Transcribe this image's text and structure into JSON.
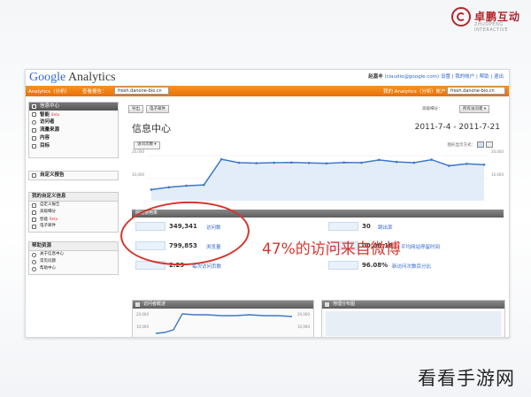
{
  "brand": {
    "name": "卓鹏互动",
    "sub": "ZHUOPENG INTERACTIVE"
  },
  "ga": {
    "logo_google": "Google",
    "logo_analytics": " Analytics",
    "account_user": "赵嘉丰",
    "account_email": "(claudio@google.com)",
    "account_links": "设置 | 我的帐户 | 帮助 | 退出",
    "nav_analytics": "Analytics（分析）",
    "nav_reports": "查看报告：",
    "profile_select": "fresh.danone-bio.cn",
    "nav_right_label": "我的 Analytics（分析）帐户：",
    "account_select": "fresh.danone-bio.cn"
  },
  "sidebar": {
    "main_head": "信息中心",
    "items": [
      {
        "label": "智能",
        "badge": "Beta"
      },
      {
        "label": "访问者",
        "badge": ""
      },
      {
        "label": "流量来源",
        "badge": ""
      },
      {
        "label": "内容",
        "badge": ""
      },
      {
        "label": "目标",
        "badge": ""
      }
    ],
    "custom_reports": "自定义报告",
    "my_custom_head": "我的自定义信息",
    "my_custom_items": [
      {
        "label": "自定义报告",
        "badge": ""
      },
      {
        "label": "高级细分",
        "badge": ""
      },
      {
        "label": "智能",
        "badge": "Beta"
      },
      {
        "label": "电子邮件",
        "badge": ""
      }
    ],
    "help_head": "帮助资源",
    "help_items": [
      "关于信息中心",
      "常见问题",
      "帮助中心"
    ]
  },
  "toolbar": {
    "export_label": "导出",
    "email_label": "电子邮件",
    "compare_label": "高级细分：",
    "compare_value": "所有访问者 ▾"
  },
  "dashboard": {
    "title": "信息中心",
    "date_range": "2011-7-4 - 2011-7-21",
    "graph_button": "访问次数 ▾",
    "graph_mode_label": "图形显示方式："
  },
  "chart_data": {
    "type": "area",
    "series": [
      {
        "values": [
          5100,
          6200,
          6900,
          7300,
          19100,
          17500,
          17300,
          17500,
          17600,
          17400,
          17200,
          17600,
          17500,
          18800,
          17900,
          17500,
          18900,
          16100,
          17000,
          16600
        ]
      }
    ],
    "y_ticks_left": [
      "20,000",
      "10,000"
    ],
    "y_ticks_right": [
      "20,000",
      "10,000"
    ],
    "ylim": [
      0,
      22000
    ],
    "grid": true
  },
  "site_usage": {
    "header": "网站使用率",
    "metrics": [
      {
        "value": "349,341",
        "label": "访问数"
      },
      {
        "value": "799,853",
        "label": "浏览量"
      },
      {
        "value": "2.29",
        "label": "每次访问页数"
      },
      {
        "value": "30",
        "label": "跳出率"
      },
      {
        "value": "00:00:18",
        "label": "平均网站停留时间"
      },
      {
        "value": "96.08%",
        "label": "新访问次数百分比"
      }
    ]
  },
  "panels": {
    "visitors_overview": "访问者概述",
    "map_overlay": "地理分布图",
    "visitors_y": [
      "20,000",
      "10,000"
    ]
  },
  "annotation": "47%的访问来自微博",
  "watermark": "看看手游网"
}
